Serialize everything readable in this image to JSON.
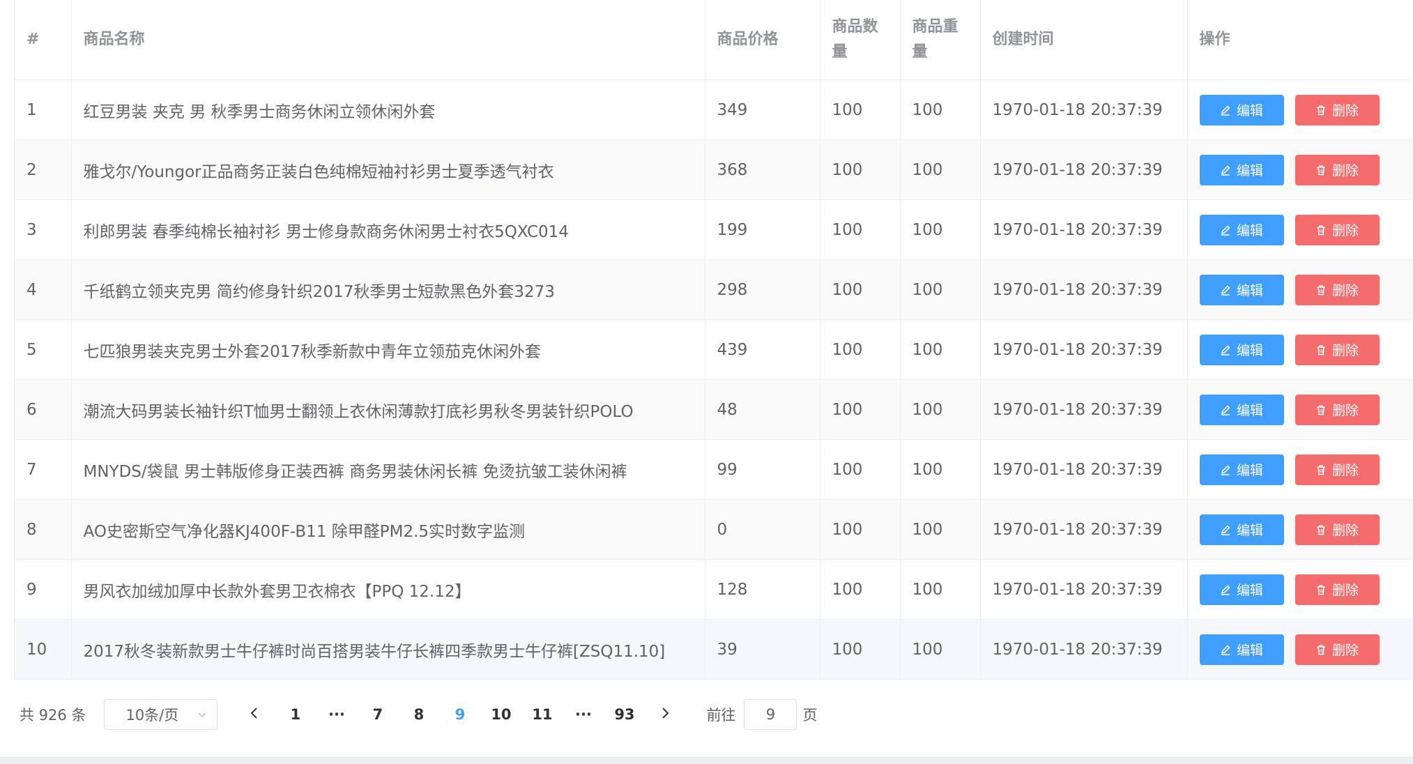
{
  "table": {
    "headers": {
      "index": "#",
      "name": "商品名称",
      "price": "商品价格",
      "quantity": "商品数量",
      "weight": "商品重量",
      "created": "创建时间",
      "actions": "操作"
    },
    "edit_label": "编辑",
    "delete_label": "删除",
    "rows": [
      {
        "index": "1",
        "name": "红豆男装 夹克 男 秋季男士商务休闲立领休闲外套",
        "price": "349",
        "quantity": "100",
        "weight": "100",
        "created": "1970-01-18 20:37:39"
      },
      {
        "index": "2",
        "name": "雅戈尔/Youngor正品商务正装白色纯棉短袖衬衫男士夏季透气衬衣",
        "price": "368",
        "quantity": "100",
        "weight": "100",
        "created": "1970-01-18 20:37:39"
      },
      {
        "index": "3",
        "name": "利郎男装 春季纯棉长袖衬衫 男士修身款商务休闲男士衬衣5QXC014",
        "price": "199",
        "quantity": "100",
        "weight": "100",
        "created": "1970-01-18 20:37:39"
      },
      {
        "index": "4",
        "name": "千纸鹤立领夹克男 简约修身针织2017秋季男士短款黑色外套3273",
        "price": "298",
        "quantity": "100",
        "weight": "100",
        "created": "1970-01-18 20:37:39"
      },
      {
        "index": "5",
        "name": "七匹狼男装夹克男士外套2017秋季新款中青年立领茄克休闲外套",
        "price": "439",
        "quantity": "100",
        "weight": "100",
        "created": "1970-01-18 20:37:39"
      },
      {
        "index": "6",
        "name": "潮流大码男装长袖针织T恤男士翻领上衣休闲薄款打底衫男秋冬男装针织POLO",
        "price": "48",
        "quantity": "100",
        "weight": "100",
        "created": "1970-01-18 20:37:39"
      },
      {
        "index": "7",
        "name": "MNYDS/袋鼠 男士韩版修身正装西裤 商务男装休闲长裤 免烫抗皱工装休闲裤",
        "price": "99",
        "quantity": "100",
        "weight": "100",
        "created": "1970-01-18 20:37:39"
      },
      {
        "index": "8",
        "name": "AO史密斯空气净化器KJ400F-B11 除甲醛PM2.5实时数字监测",
        "price": "0",
        "quantity": "100",
        "weight": "100",
        "created": "1970-01-18 20:37:39"
      },
      {
        "index": "9",
        "name": "男风衣加绒加厚中长款外套男卫衣棉衣【PPQ 12.12】",
        "price": "128",
        "quantity": "100",
        "weight": "100",
        "created": "1970-01-18 20:37:39"
      },
      {
        "index": "10",
        "name": "2017秋冬装新款男士牛仔裤时尚百搭男装牛仔长裤四季款男士牛仔裤[ZSQ11.10]",
        "price": "39",
        "quantity": "100",
        "weight": "100",
        "created": "1970-01-18 20:37:39"
      }
    ]
  },
  "pagination": {
    "total_text": "共 926 条",
    "page_size": "10条/页",
    "pages": [
      {
        "label": "1",
        "active": false
      },
      {
        "label": "···",
        "active": false
      },
      {
        "label": "7",
        "active": false
      },
      {
        "label": "8",
        "active": false
      },
      {
        "label": "9",
        "active": true
      },
      {
        "label": "10",
        "active": false
      },
      {
        "label": "11",
        "active": false
      },
      {
        "label": "···",
        "active": false
      },
      {
        "label": "93",
        "active": false
      }
    ],
    "goto_label": "前往",
    "goto_value": "9",
    "goto_suffix": "页"
  },
  "colors": {
    "primary": "#409eff",
    "danger": "#f56c6c",
    "header_text": "#909399",
    "body_text": "#606266"
  },
  "icons": {
    "edit": "edit-icon",
    "delete": "trash-icon",
    "prev": "chevron-left-icon",
    "next": "chevron-right-icon",
    "select": "chevron-down-icon"
  }
}
